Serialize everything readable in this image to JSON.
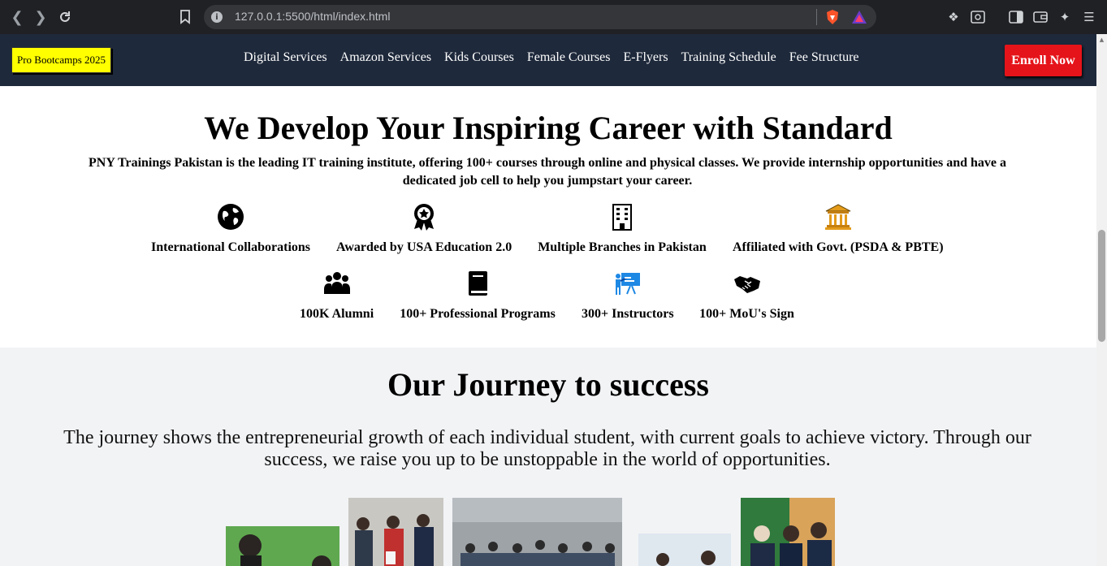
{
  "browser": {
    "url": "127.0.0.1:5500/html/index.html",
    "back_icon": "chevron-left-icon",
    "forward_icon": "chevron-right-icon",
    "reload_icon": "reload-icon"
  },
  "navbar": {
    "brand": "Pro Bootcamps 2025",
    "links": [
      "Digital Services",
      "Amazon Services",
      "Kids Courses",
      "Female Courses",
      "E-Flyers",
      "Training Schedule",
      "Fee Structure"
    ],
    "cta": "Enroll Now",
    "colors": {
      "background": "#1e293b",
      "brand_bg": "#ffff00",
      "cta_bg": "#e5141a"
    }
  },
  "hero": {
    "title": "We Develop Your Inspiring Career with Standard",
    "description": "PNY Trainings Pakistan is the leading IT training institute, offering 100+ courses through online and physical classes. We provide internship opportunities and have a dedicated job cell to help you jumpstart your career.",
    "features": [
      {
        "label": "International Collaborations",
        "icon": "globe-icon"
      },
      {
        "label": "Awarded by USA Education 2.0",
        "icon": "award-badge-icon"
      },
      {
        "label": "Multiple Branches in Pakistan",
        "icon": "building-icon"
      },
      {
        "label": "Affiliated with Govt. (PSDA & PBTE)",
        "icon": "government-building-icon"
      },
      {
        "label": "100K Alumni",
        "icon": "people-group-icon"
      },
      {
        "label": "100+ Professional Programs",
        "icon": "book-icon"
      },
      {
        "label": "300+ Instructors",
        "icon": "teacher-board-icon"
      },
      {
        "label": "100+ MoU's Sign",
        "icon": "handshake-icon"
      }
    ]
  },
  "journey": {
    "title": "Our Journey to success",
    "description": "The journey shows the entrepreneurial growth of each individual student, with current goals to achieve victory. Through our success, we raise you up to be unstoppable in the world of opportunities."
  }
}
